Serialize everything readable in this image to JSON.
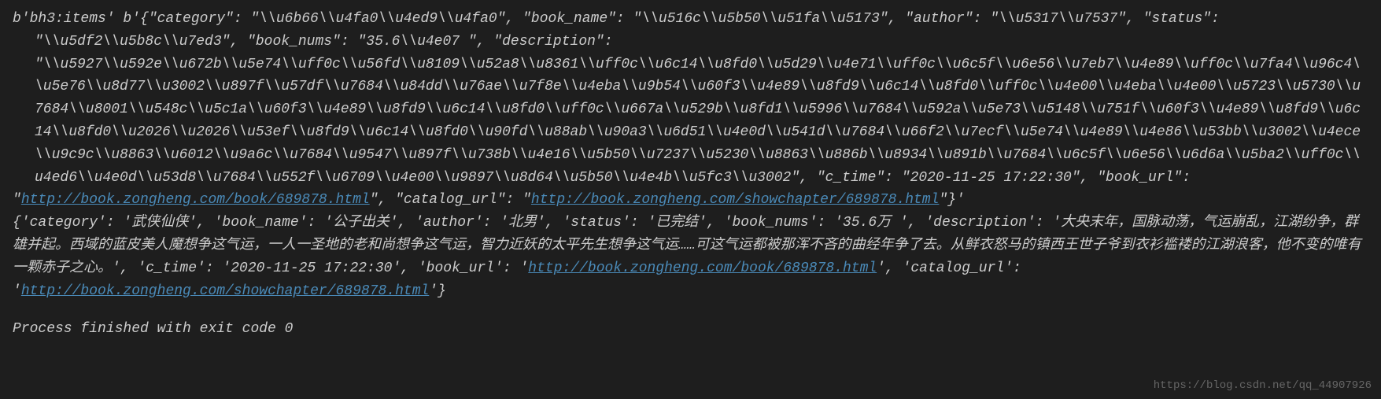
{
  "console": {
    "line1_prefix": "b'bh3:items' b'{\"category\": \"\\\\u6b66\\\\u4fa0\\\\u4ed9\\\\u4fa0\", \"book_name\": \"\\\\u516c\\\\u5b50\\\\u51fa\\\\u5173\", \"author\": \"\\\\u5317\\\\u7537\", \"status\":",
    "line2_indent": "\"\\\\u5df2\\\\u5b8c\\\\u7ed3\", \"book_nums\": \"35.6\\\\u4e07 \", \"description\":",
    "line3_indent": "\"\\\\u5927\\\\u592e\\\\u672b\\\\u5e74\\\\uff0c\\\\u56fd\\\\u8109\\\\u52a8\\\\u8361\\\\uff0c\\\\u6c14\\\\u8fd0\\\\u5d29\\\\u4e71\\\\uff0c\\\\u6c5f\\\\u6e56\\\\u7eb7\\\\u4e89\\\\uff0c\\\\u7fa4\\\\u96c4\\\\u5e76\\\\u8d77\\\\u3002\\\\u897f\\\\u57df\\\\u7684\\\\u84dd\\\\u76ae\\\\u7f8e\\\\u4eba\\\\u9b54\\\\u60f3\\\\u4e89\\\\u8fd9\\\\u6c14\\\\u8fd0\\\\uff0c\\\\u4e00\\\\u4eba\\\\u4e00\\\\u5723\\\\u5730\\\\u7684\\\\u8001\\\\u548c\\\\u5c1a\\\\u60f3\\\\u4e89\\\\u8fd9\\\\u6c14\\\\u8fd0\\\\uff0c\\\\u667a\\\\u529b\\\\u8fd1\\\\u5996\\\\u7684\\\\u592a\\\\u5e73\\\\u5148\\\\u751f\\\\u60f3\\\\u4e89\\\\u8fd9\\\\u6c14\\\\u8fd0\\\\u2026\\\\u2026\\\\u53ef\\\\u8fd9\\\\u6c14\\\\u8fd0\\\\u90fd\\\\u88ab\\\\u90a3\\\\u6d51\\\\u4e0d\\\\u541d\\\\u7684\\\\u66f2\\\\u7ecf\\\\u5e74\\\\u4e89\\\\u4e86\\\\u53bb\\\\u3002\\\\u4ece\\\\u9c9c\\\\u8863\\\\u6012\\\\u9a6c\\\\u7684\\\\u9547\\\\u897f\\\\u738b\\\\u4e16\\\\u5b50\\\\u7237\\\\u5230\\\\u8863\\\\u886b\\\\u8934\\\\u891b\\\\u7684\\\\u6c5f\\\\u6e56\\\\u6d6a\\\\u5ba2\\\\uff0c\\\\u4ed6\\\\u4e0d\\\\u53d8\\\\u7684\\\\u552f\\\\u6709\\\\u4e00\\\\u9897\\\\u8d64\\\\u5b50\\\\u4e4b\\\\u5fc3\\\\u3002\", \"c_time\": \"2020-11-25 17:22:30\", \"book_url\":",
    "line4_prefix": "\"",
    "line4_link1": "http://book.zongheng.com/book/689878.html",
    "line4_mid": "\", \"catalog_url\": \"",
    "line4_link2": "http://book.zongheng.com/showchapter/689878.html",
    "line4_suffix": "\"}'",
    "line5_part1": "{'category': '武侠仙侠', 'book_name': '公子出关', 'author': '北男', 'status': '已完结', 'book_nums': '35.6万 ', 'description': '大央末年，国脉动荡，气运崩乱，江湖纷争，群雄并起。西域的蓝皮美人魔想争这气运，一人一圣地的老和尚想争这气运，智力近妖的太平先生想争这气运……可这气运都被那浑不吝的曲经年争了去。从鲜衣怒马的镇西王世子爷到衣衫褴褛的江湖浪客，他不变的唯有一颗赤子之心。', 'c_time': '2020-11-25 17:22:30', 'book_url': '",
    "line5_link1": "http://book.zongheng.com/book/689878.html",
    "line5_mid": "', 'catalog_url': '",
    "line5_link2": "http://book.zongheng.com/showchapter/689878.html",
    "line5_suffix": "'}",
    "process_exit": "Process finished with exit code 0"
  },
  "watermark": "https://blog.csdn.net/qq_44907926"
}
